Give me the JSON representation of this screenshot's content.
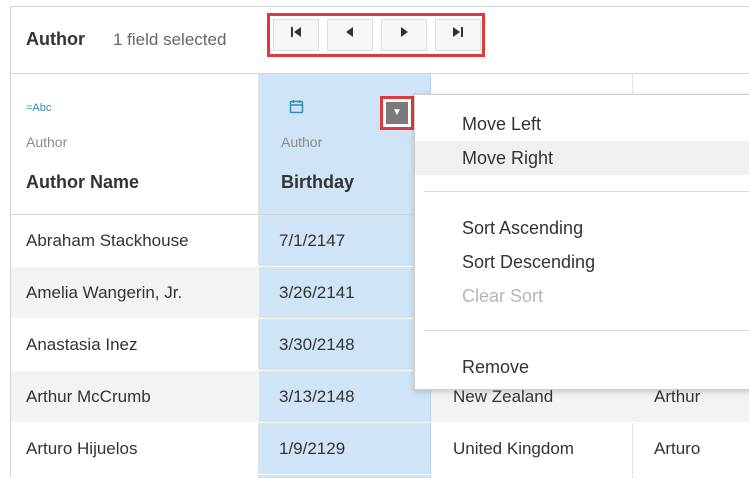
{
  "toolbar": {
    "title": "Author",
    "selection_status": "1 field selected",
    "nav": {
      "first_icon": "first-icon",
      "prev_icon": "previous-icon",
      "next_icon": "next-icon",
      "last_icon": "last-icon"
    }
  },
  "columns": [
    {
      "type_icon": "string-type-icon",
      "type_glyph": "=Abc",
      "source": "Author",
      "name": "Author Name"
    },
    {
      "type_icon": "date-type-icon",
      "type_glyph": "▦",
      "source": "Author",
      "name": "Birthday"
    }
  ],
  "rows": [
    {
      "author": "Abraham Stackhouse",
      "birthday": "7/1/2147",
      "country": "",
      "first": ""
    },
    {
      "author": "Amelia Wangerin, Jr.",
      "birthday": "3/26/2141",
      "country": "",
      "first": ""
    },
    {
      "author": "Anastasia Inez",
      "birthday": "3/30/2148",
      "country": "",
      "first": ""
    },
    {
      "author": "Arthur McCrumb",
      "birthday": "3/13/2148",
      "country": "New Zealand",
      "first": "Arthur"
    },
    {
      "author": "Arturo Hijuelos",
      "birthday": "1/9/2129",
      "country": "United Kingdom",
      "first": "Arturo"
    }
  ],
  "menu": {
    "items": [
      {
        "label": "Move Left",
        "state": "normal"
      },
      {
        "label": "Move Right",
        "state": "hover"
      },
      {
        "label": "Sort Ascending",
        "state": "normal"
      },
      {
        "label": "Sort Descending",
        "state": "normal"
      },
      {
        "label": "Clear Sort",
        "state": "disabled"
      },
      {
        "label": "Remove",
        "state": "normal"
      }
    ]
  },
  "colors": {
    "selected_column": "#cfe5f7",
    "highlight_border": "#dd3b3b",
    "type_icon": "#2e8fb8",
    "row_shade": "#f3f3f3"
  }
}
